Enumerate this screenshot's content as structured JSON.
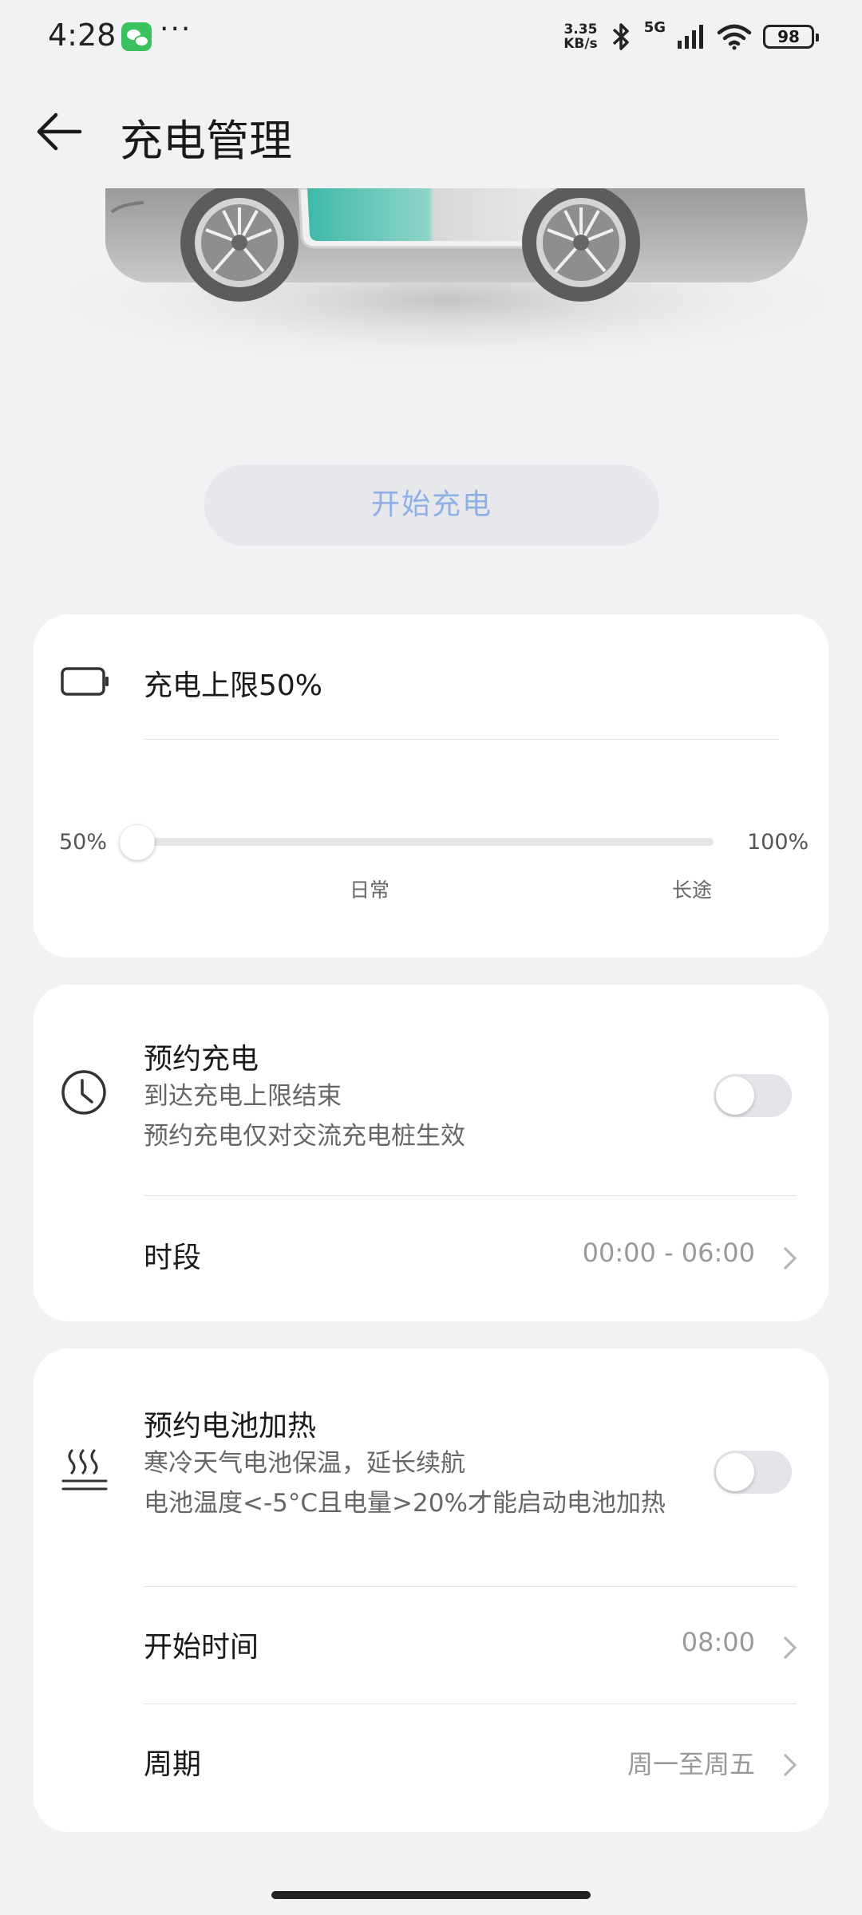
{
  "status_bar": {
    "time": "4:28",
    "more": "···",
    "net_speed_value": "3.35",
    "net_speed_unit": "KB/s",
    "network": "5G",
    "battery": "98"
  },
  "header": {
    "back_icon": "back-arrow-icon",
    "title": "充电管理"
  },
  "start_button": {
    "label": "开始充电"
  },
  "charge_limit": {
    "icon": "battery-icon",
    "title": "充电上限50%",
    "slider_min_label": "50%",
    "slider_max_label": "100%",
    "value_percent": 50,
    "tick_daily": "日常",
    "tick_long": "长途"
  },
  "scheduled_charging": {
    "icon": "clock-icon",
    "title": "预约充电",
    "subtitle_1": "到达充电上限结束",
    "subtitle_2": "预约充电仅对交流充电桩生效",
    "enabled": false,
    "period_label": "时段",
    "period_value": "00:00 - 06:00"
  },
  "battery_heating": {
    "icon": "heating-icon",
    "title": "预约电池加热",
    "subtitle_1": "寒冷天气电池保温，延长续航",
    "subtitle_2": "电池温度<-5°C且电量>20%才能启动电池加热",
    "enabled": false,
    "start_time_label": "开始时间",
    "start_time_value": "08:00",
    "cycle_label": "周期",
    "cycle_value": "周一至周五"
  },
  "colors": {
    "background": "#f1f2f4",
    "card": "#ffffff",
    "accent_text": "#8fb0e6",
    "battery_teal": "#3fb9a8"
  }
}
